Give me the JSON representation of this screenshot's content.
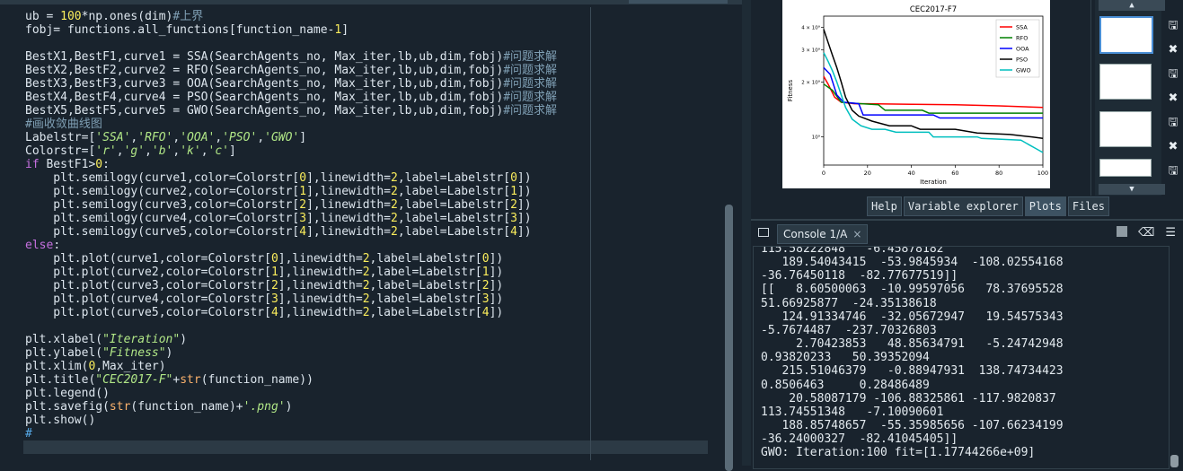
{
  "editor": {
    "lines": [
      [
        {
          "t": "ub = "
        },
        {
          "t": "100",
          "c": "num"
        },
        {
          "t": "*np.ones(dim)"
        },
        {
          "t": "#上界",
          "c": "cmt"
        }
      ],
      [
        {
          "t": "fobj= functions.all_functions[function_name-"
        },
        {
          "t": "1",
          "c": "num"
        },
        {
          "t": "]"
        }
      ],
      [
        {
          "t": ""
        }
      ],
      [
        {
          "t": "BestX1,BestF1,curve1 = SSA(SearchAgents_no, Max_iter,lb,ub,dim,fobj)"
        },
        {
          "t": "#问题求解",
          "c": "cmt"
        }
      ],
      [
        {
          "t": "BestX2,BestF2,curve2 = RFO(SearchAgents_no, Max_iter,lb,ub,dim,fobj)"
        },
        {
          "t": "#问题求解",
          "c": "cmt"
        }
      ],
      [
        {
          "t": "BestX3,BestF3,curve3 = OOA(SearchAgents_no, Max_iter,lb,ub,dim,fobj)"
        },
        {
          "t": "#问题求解",
          "c": "cmt"
        }
      ],
      [
        {
          "t": "BestX4,BestF4,curve4 = PSO(SearchAgents_no, Max_iter,lb,ub,dim,fobj)"
        },
        {
          "t": "#问题求解",
          "c": "cmt"
        }
      ],
      [
        {
          "t": "BestX5,BestF5,curve5 = GWO(SearchAgents_no, Max_iter,lb,ub,dim,fobj)"
        },
        {
          "t": "#问题求解",
          "c": "cmt"
        }
      ],
      [
        {
          "t": "#画收敛曲线图",
          "c": "cmt"
        }
      ],
      [
        {
          "t": "Labelstr=["
        },
        {
          "t": "'SSA'",
          "c": "str"
        },
        {
          "t": ","
        },
        {
          "t": "'RFO'",
          "c": "str"
        },
        {
          "t": ","
        },
        {
          "t": "'OOA'",
          "c": "str"
        },
        {
          "t": ","
        },
        {
          "t": "'PSO'",
          "c": "str"
        },
        {
          "t": ","
        },
        {
          "t": "'GWO'",
          "c": "str"
        },
        {
          "t": "]"
        }
      ],
      [
        {
          "t": "Colorstr=["
        },
        {
          "t": "'r'",
          "c": "str"
        },
        {
          "t": ","
        },
        {
          "t": "'g'",
          "c": "str"
        },
        {
          "t": ","
        },
        {
          "t": "'b'",
          "c": "str"
        },
        {
          "t": ","
        },
        {
          "t": "'k'",
          "c": "str"
        },
        {
          "t": ","
        },
        {
          "t": "'c'",
          "c": "str"
        },
        {
          "t": "]"
        }
      ],
      [
        {
          "t": "if",
          "c": "kw"
        },
        {
          "t": " BestF1>"
        },
        {
          "t": "0",
          "c": "num"
        },
        {
          "t": ":"
        }
      ],
      [
        {
          "t": "    plt.semilogy(curve1,color=Colorstr["
        },
        {
          "t": "0",
          "c": "num"
        },
        {
          "t": "],linewidth="
        },
        {
          "t": "2",
          "c": "num"
        },
        {
          "t": ",label=Labelstr["
        },
        {
          "t": "0",
          "c": "num"
        },
        {
          "t": "])"
        }
      ],
      [
        {
          "t": "    plt.semilogy(curve2,color=Colorstr["
        },
        {
          "t": "1",
          "c": "num"
        },
        {
          "t": "],linewidth="
        },
        {
          "t": "2",
          "c": "num"
        },
        {
          "t": ",label=Labelstr["
        },
        {
          "t": "1",
          "c": "num"
        },
        {
          "t": "])"
        }
      ],
      [
        {
          "t": "    plt.semilogy(curve3,color=Colorstr["
        },
        {
          "t": "2",
          "c": "num"
        },
        {
          "t": "],linewidth="
        },
        {
          "t": "2",
          "c": "num"
        },
        {
          "t": ",label=Labelstr["
        },
        {
          "t": "2",
          "c": "num"
        },
        {
          "t": "])"
        }
      ],
      [
        {
          "t": "    plt.semilogy(curve4,color=Colorstr["
        },
        {
          "t": "3",
          "c": "num"
        },
        {
          "t": "],linewidth="
        },
        {
          "t": "2",
          "c": "num"
        },
        {
          "t": ",label=Labelstr["
        },
        {
          "t": "3",
          "c": "num"
        },
        {
          "t": "])"
        }
      ],
      [
        {
          "t": "    plt.semilogy(curve5,color=Colorstr["
        },
        {
          "t": "4",
          "c": "num"
        },
        {
          "t": "],linewidth="
        },
        {
          "t": "2",
          "c": "num"
        },
        {
          "t": ",label=Labelstr["
        },
        {
          "t": "4",
          "c": "num"
        },
        {
          "t": "])"
        }
      ],
      [
        {
          "t": "else",
          "c": "kw"
        },
        {
          "t": ":"
        }
      ],
      [
        {
          "t": "    plt.plot(curve1,color=Colorstr["
        },
        {
          "t": "0",
          "c": "num"
        },
        {
          "t": "],linewidth="
        },
        {
          "t": "2",
          "c": "num"
        },
        {
          "t": ",label=Labelstr["
        },
        {
          "t": "0",
          "c": "num"
        },
        {
          "t": "])"
        }
      ],
      [
        {
          "t": "    plt.plot(curve2,color=Colorstr["
        },
        {
          "t": "1",
          "c": "num"
        },
        {
          "t": "],linewidth="
        },
        {
          "t": "2",
          "c": "num"
        },
        {
          "t": ",label=Labelstr["
        },
        {
          "t": "1",
          "c": "num"
        },
        {
          "t": "])"
        }
      ],
      [
        {
          "t": "    plt.plot(curve3,color=Colorstr["
        },
        {
          "t": "2",
          "c": "num"
        },
        {
          "t": "],linewidth="
        },
        {
          "t": "2",
          "c": "num"
        },
        {
          "t": ",label=Labelstr["
        },
        {
          "t": "2",
          "c": "num"
        },
        {
          "t": "])"
        }
      ],
      [
        {
          "t": "    plt.plot(curve4,color=Colorstr["
        },
        {
          "t": "3",
          "c": "num"
        },
        {
          "t": "],linewidth="
        },
        {
          "t": "2",
          "c": "num"
        },
        {
          "t": ",label=Labelstr["
        },
        {
          "t": "3",
          "c": "num"
        },
        {
          "t": "])"
        }
      ],
      [
        {
          "t": "    plt.plot(curve5,color=Colorstr["
        },
        {
          "t": "4",
          "c": "num"
        },
        {
          "t": "],linewidth="
        },
        {
          "t": "2",
          "c": "num"
        },
        {
          "t": ",label=Labelstr["
        },
        {
          "t": "4",
          "c": "num"
        },
        {
          "t": "])"
        }
      ],
      [
        {
          "t": ""
        }
      ],
      [
        {
          "t": "plt.xlabel("
        },
        {
          "t": "\"Iteration\"",
          "c": "str"
        },
        {
          "t": ")"
        }
      ],
      [
        {
          "t": "plt.ylabel("
        },
        {
          "t": "\"Fitness\"",
          "c": "str"
        },
        {
          "t": ")"
        }
      ],
      [
        {
          "t": "plt.xlim("
        },
        {
          "t": "0",
          "c": "num"
        },
        {
          "t": ",Max_iter)"
        }
      ],
      [
        {
          "t": "plt.title("
        },
        {
          "t": "\"CEC2017-F\"",
          "c": "str"
        },
        {
          "t": "+"
        },
        {
          "t": "str",
          "c": "bi"
        },
        {
          "t": "(function_name))"
        }
      ],
      [
        {
          "t": "plt.legend()"
        }
      ],
      [
        {
          "t": "plt.savefig("
        },
        {
          "t": "str",
          "c": "bi"
        },
        {
          "t": "(function_name)+"
        },
        {
          "t": "'.png'",
          "c": "str"
        },
        {
          "t": ")"
        }
      ],
      [
        {
          "t": "plt.show()"
        }
      ],
      [
        {
          "t": "#",
          "c": "cur"
        }
      ]
    ]
  },
  "tabs": [
    "Help",
    "Variable explorer",
    "Plots",
    "Files"
  ],
  "active_tab": "Plots",
  "console": {
    "tab_label": "Console 1/A",
    "close_glyph": "×",
    "output": "115.58222848   -6.45878182\n   189.54043415  -53.9845934  -108.02554168\n-36.76450118  -82.77677519]]\n[[   8.60500063  -10.99597056   78.37695528\n51.66925877  -24.35138618\n   124.91334746  -32.05672947   19.54575343\n-5.7674487  -237.70326803\n     2.70423853   48.85634791   -5.24742948\n0.93820233   50.39352094\n   215.51046379   -0.88947931  138.74734423\n0.8506463     0.28486489\n    20.58087179 -106.88325861 -117.9820837\n113.74551348   -7.10090601\n   188.85748657  -55.35985656 -107.66234199\n-36.24000327  -82.41045405]]\nGWO: Iteration:100 fit=[1.17744266e+09]"
  },
  "thumbnails": {
    "up_glyph": "▲",
    "down_glyph": "▼",
    "save_glyph": "🖫",
    "close_glyph": "✖"
  },
  "chart_data": {
    "type": "line",
    "title": "CEC2017-F7",
    "xlabel": "Iteration",
    "ylabel": "Fitness",
    "xlim": [
      0,
      100
    ],
    "yscale": "log",
    "ylim": [
      700000000,
      4600000000
    ],
    "yticks": [
      {
        "value": 1000000000,
        "label": "10⁹"
      },
      {
        "value": 2000000000,
        "label": "2 × 10⁹"
      },
      {
        "value": 3000000000,
        "label": "3 × 10⁹"
      },
      {
        "value": 4000000000,
        "label": "4 × 10⁹"
      }
    ],
    "xticks": [
      0,
      20,
      40,
      60,
      80,
      100
    ],
    "legend_position": "top-right",
    "series": [
      {
        "name": "SSA",
        "color": "#ff0000",
        "points": [
          [
            0,
            2150000000
          ],
          [
            2,
            1950000000
          ],
          [
            5,
            1650000000
          ],
          [
            8,
            1550000000
          ],
          [
            14,
            1520000000
          ],
          [
            20,
            1520000000
          ],
          [
            40,
            1510000000
          ],
          [
            60,
            1500000000
          ],
          [
            80,
            1480000000
          ],
          [
            100,
            1450000000
          ]
        ]
      },
      {
        "name": "RFO",
        "color": "#008000",
        "points": [
          [
            0,
            1950000000
          ],
          [
            4,
            1800000000
          ],
          [
            8,
            1550000000
          ],
          [
            14,
            1530000000
          ],
          [
            25,
            1500000000
          ],
          [
            28,
            1400000000
          ],
          [
            45,
            1400000000
          ],
          [
            48,
            1350000000
          ],
          [
            100,
            1350000000
          ]
        ]
      },
      {
        "name": "OOA",
        "color": "#0000ff",
        "points": [
          [
            0,
            2400000000
          ],
          [
            3,
            2200000000
          ],
          [
            6,
            1700000000
          ],
          [
            9,
            1550000000
          ],
          [
            16,
            1520000000
          ],
          [
            18,
            1320000000
          ],
          [
            50,
            1320000000
          ],
          [
            53,
            1270000000
          ],
          [
            100,
            1270000000
          ]
        ]
      },
      {
        "name": "PSO",
        "color": "#000000",
        "points": [
          [
            0,
            3900000000
          ],
          [
            2,
            3300000000
          ],
          [
            4,
            2800000000
          ],
          [
            6,
            2400000000
          ],
          [
            8,
            2000000000
          ],
          [
            10,
            1650000000
          ],
          [
            13,
            1400000000
          ],
          [
            16,
            1300000000
          ],
          [
            22,
            1220000000
          ],
          [
            30,
            1150000000
          ],
          [
            40,
            1150000000
          ],
          [
            44,
            1100000000
          ],
          [
            60,
            1100000000
          ],
          [
            70,
            1050000000
          ],
          [
            85,
            1030000000
          ],
          [
            95,
            1000000000
          ],
          [
            100,
            980000000
          ]
        ]
      },
      {
        "name": "GWO",
        "color": "#00bfbf",
        "points": [
          [
            0,
            2900000000
          ],
          [
            2,
            2600000000
          ],
          [
            4,
            2300000000
          ],
          [
            6,
            2000000000
          ],
          [
            8,
            1700000000
          ],
          [
            10,
            1450000000
          ],
          [
            13,
            1250000000
          ],
          [
            17,
            1150000000
          ],
          [
            22,
            1100000000
          ],
          [
            28,
            1100000000
          ],
          [
            33,
            1060000000
          ],
          [
            48,
            1060000000
          ],
          [
            50,
            1000000000
          ],
          [
            70,
            1000000000
          ],
          [
            72,
            980000000
          ],
          [
            90,
            960000000
          ],
          [
            94,
            900000000
          ],
          [
            97,
            860000000
          ],
          [
            100,
            820000000
          ]
        ]
      }
    ]
  }
}
